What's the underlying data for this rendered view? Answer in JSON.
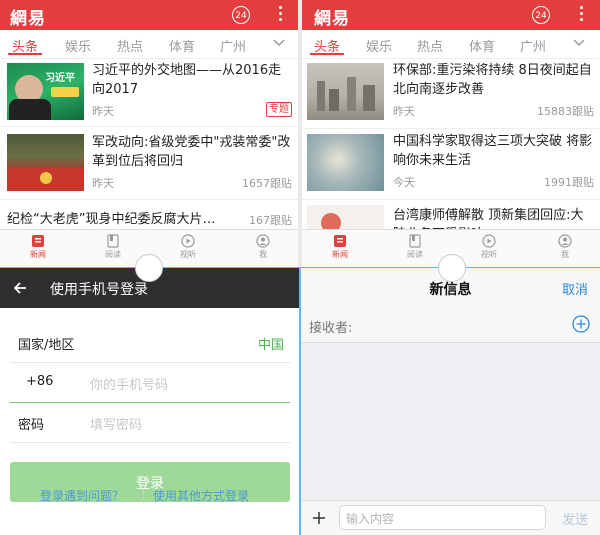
{
  "news_app": {
    "logo": "網易",
    "badge": "24",
    "tabs": [
      "头条",
      "娱乐",
      "热点",
      "体育",
      "广州"
    ],
    "bottom_nav": [
      "新闻",
      "阅读",
      "视听",
      "我"
    ]
  },
  "left_feed": [
    {
      "title": "习近平的外交地图——从2016走向2017",
      "meta": "昨天",
      "tag": "专题",
      "thumb_text": "习近平"
    },
    {
      "title": "军改动向:省级党委中\"戎装常委\"改革到位后将回归",
      "meta": "昨天",
      "count": "1657跟贴"
    },
    {
      "title": "纪检“大老虎”现身中纪委反腐大片…",
      "count": "167跟贴"
    }
  ],
  "right_feed": [
    {
      "title": "环保部:重污染将持续 8日夜间起自北向南逐步改善",
      "meta": "昨天",
      "count": "15883跟贴"
    },
    {
      "title": "中国科学家取得这三项大突破 将影响你未来生活",
      "meta": "今天",
      "count": "1991跟贴"
    },
    {
      "title": "台湾康师傅解散 顶新集团回应:大陆业务不受影响"
    }
  ],
  "login": {
    "title": "使用手机号登录",
    "country_label": "国家/地区",
    "country_value": "中国",
    "code": "+86",
    "phone_placeholder": "你的手机号码",
    "password_label": "密码",
    "password_placeholder": "填写密码",
    "button": "登录",
    "link_problem": "登录遇到问题？",
    "link_other": "使用其他方式登录"
  },
  "message": {
    "title": "新信息",
    "cancel": "取消",
    "recipient_label": "接收者:",
    "input_placeholder": "输入内容",
    "send": "发送"
  },
  "colors": {
    "brand": "#e33e3e",
    "login_green": "#4caf50",
    "ios_blue": "#2b8ad6"
  }
}
